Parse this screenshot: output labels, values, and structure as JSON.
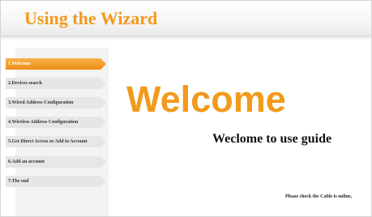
{
  "header": {
    "title": "Using the Wizard"
  },
  "sidebar": {
    "active_index": 0,
    "steps": [
      {
        "label": "1.Welcome"
      },
      {
        "label": "2.Devices search"
      },
      {
        "label": "3.Wired Address Configuration"
      },
      {
        "label": "4.Wireless Address Configuration"
      },
      {
        "label": "5.Get Direct Access or Add to Account"
      },
      {
        "label": "6.Add an account"
      },
      {
        "label": "7.The end"
      }
    ]
  },
  "main": {
    "heading": "Welcome",
    "subheading": "Weclome to use guide",
    "note": "Please check the Cable is online,"
  },
  "colors": {
    "accent": "#f29a1c",
    "active_step_bg": "#f4a030",
    "step_bg": "#e6e6e6",
    "sidebar_bg": "#f3f3f3"
  }
}
